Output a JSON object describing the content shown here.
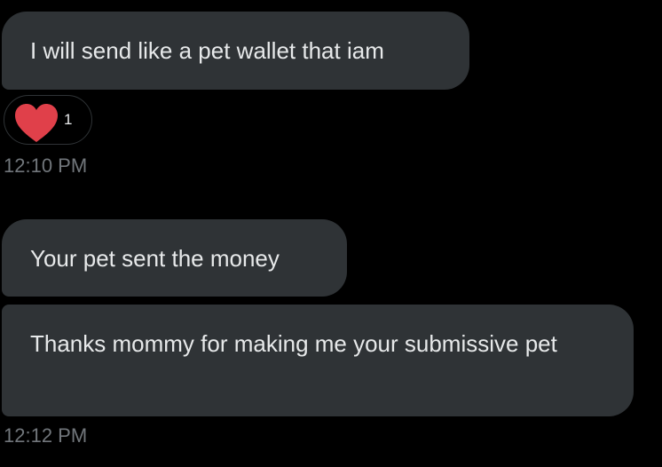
{
  "colors": {
    "background": "#000000",
    "bubble": "#2f3336",
    "text": "#e7e9ea",
    "timestamp": "#71767b",
    "heart": "#f4212e"
  },
  "messages": [
    {
      "text": "I will send like a pet wallet that iam"
    },
    {
      "text": "Your pet sent the money"
    },
    {
      "text": "Thanks mommy for making me your submissive pet"
    }
  ],
  "reaction": {
    "icon": "heart-icon",
    "count": "1"
  },
  "timestamps": [
    "12:10 PM",
    "12:12 PM"
  ]
}
